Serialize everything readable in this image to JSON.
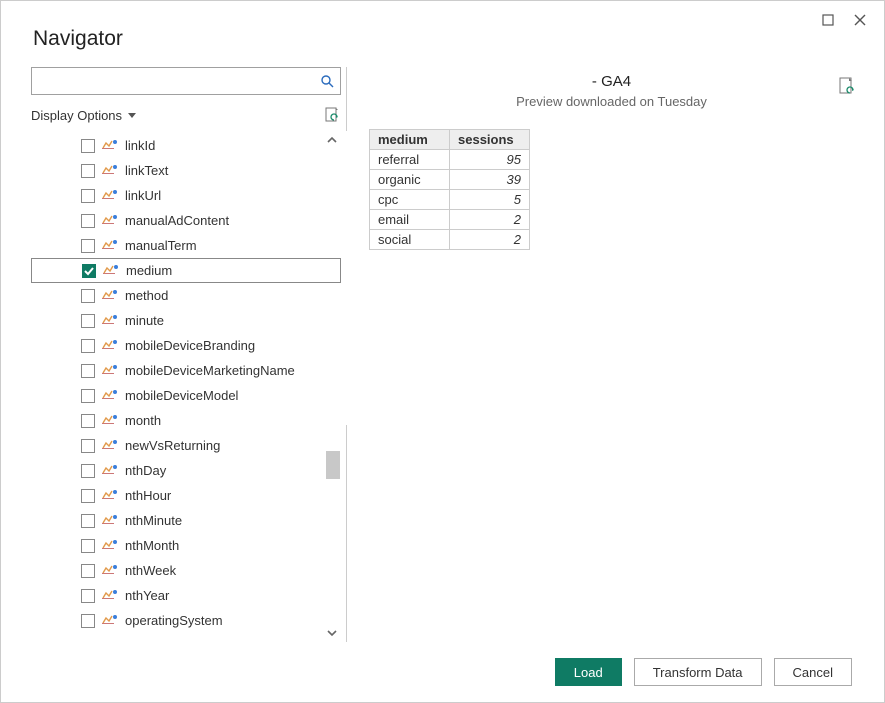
{
  "window": {
    "title": "Navigator"
  },
  "search": {
    "placeholder": ""
  },
  "displayOptions": {
    "label": "Display Options"
  },
  "tree": {
    "items": [
      {
        "label": "linkId",
        "checked": false
      },
      {
        "label": "linkText",
        "checked": false
      },
      {
        "label": "linkUrl",
        "checked": false
      },
      {
        "label": "manualAdContent",
        "checked": false
      },
      {
        "label": "manualTerm",
        "checked": false
      },
      {
        "label": "medium",
        "checked": true,
        "selected": true
      },
      {
        "label": "method",
        "checked": false
      },
      {
        "label": "minute",
        "checked": false
      },
      {
        "label": "mobileDeviceBranding",
        "checked": false
      },
      {
        "label": "mobileDeviceMarketingName",
        "checked": false
      },
      {
        "label": "mobileDeviceModel",
        "checked": false
      },
      {
        "label": "month",
        "checked": false
      },
      {
        "label": "newVsReturning",
        "checked": false
      },
      {
        "label": "nthDay",
        "checked": false
      },
      {
        "label": "nthHour",
        "checked": false
      },
      {
        "label": "nthMinute",
        "checked": false
      },
      {
        "label": "nthMonth",
        "checked": false
      },
      {
        "label": "nthWeek",
        "checked": false
      },
      {
        "label": "nthYear",
        "checked": false
      },
      {
        "label": "operatingSystem",
        "checked": false
      }
    ]
  },
  "preview": {
    "title": "- GA4",
    "subtitle": "Preview downloaded on Tuesday",
    "columns": [
      "medium",
      "sessions"
    ],
    "rows": [
      {
        "medium": "referral",
        "sessions": "95"
      },
      {
        "medium": "organic",
        "sessions": "39"
      },
      {
        "medium": "cpc",
        "sessions": "5"
      },
      {
        "medium": "email",
        "sessions": "2"
      },
      {
        "medium": "social",
        "sessions": "2"
      }
    ]
  },
  "footer": {
    "load": "Load",
    "transform": "Transform Data",
    "cancel": "Cancel"
  }
}
